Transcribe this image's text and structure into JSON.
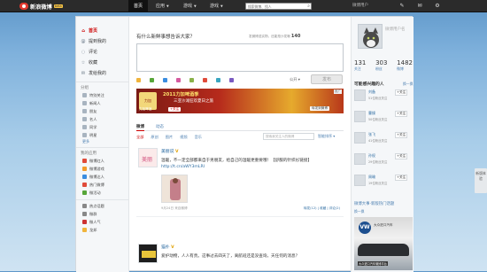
{
  "topbar": {
    "brand": "新浪微博",
    "beta": "beta",
    "nav": {
      "home": "首页",
      "apps": "应用",
      "games": "游戏",
      "games2": "游戏"
    },
    "search_placeholder": "搜索微博、找人",
    "username": "微博用户"
  },
  "left_nav": {
    "items": [
      {
        "label": "首页",
        "icon": "home-icon"
      },
      {
        "label": "提到我的",
        "icon": "at-icon"
      },
      {
        "label": "评论",
        "icon": "comment-icon"
      },
      {
        "label": "收藏",
        "icon": "star-icon"
      },
      {
        "label": "发给我的",
        "icon": "mail-icon"
      }
    ],
    "group_title": "分组",
    "groups": [
      "特别关注",
      "新闻人",
      "朋友",
      "名人",
      "同学",
      "明星"
    ],
    "group_more": "更多",
    "apps_title": "我的应用",
    "apps": [
      {
        "label": "微博红人",
        "color": "#e04b3a"
      },
      {
        "label": "微博游戏",
        "color": "#f39c2b"
      },
      {
        "label": "微博达人",
        "color": "#3a8de0"
      },
      {
        "label": "热门微博",
        "color": "#e04b3a"
      },
      {
        "label": "微活动",
        "color": "#57a639"
      }
    ],
    "bottom": [
      {
        "label": "热点话题",
        "color": "#888888"
      },
      {
        "label": "微群",
        "color": "#888888"
      },
      {
        "label": "微人气",
        "color": "#888888"
      },
      {
        "label": "龙邦",
        "color": "#888888"
      }
    ]
  },
  "publisher": {
    "title": "有什么新鲜事想告诉大家？",
    "hint": "发微博送实物，还能抢沙发哦",
    "count": "140",
    "tools": [
      {
        "label": "表情",
        "color": "#f0b43c"
      },
      {
        "label": "图片",
        "color": "#57a639"
      },
      {
        "label": "视频",
        "color": "#3a8de0"
      },
      {
        "label": "音乐",
        "color": "#d55a9f"
      },
      {
        "label": "话题",
        "color": "#8ab24a"
      },
      {
        "label": "活动",
        "color": "#e04b3a"
      },
      {
        "label": "投票",
        "color": "#3aa6c1"
      },
      {
        "label": "长微博",
        "color": "#7a5ac1"
      }
    ],
    "setting": "公开 ▾",
    "submit": "发布"
  },
  "ad": {
    "logo": "力加",
    "headline": "2011力加啤酒季",
    "subline": "三亚沙滩狂欢夏日之旅",
    "follow_name": "力加啤酒",
    "follow_btn": "+关注",
    "share_btn": "转发到微博",
    "tag": "推广"
  },
  "feed_tabs": {
    "weibo": "微博",
    "dynamic": "动态"
  },
  "filters": [
    "全部",
    "原创",
    "图片",
    "视频",
    "音乐"
  ],
  "feed_search_placeholder": "搜索我关注人的微博",
  "sort": "智能排序 ▾",
  "feed": [
    {
      "name": "美丽说",
      "text": "温暖，不一定全部都来自于男朋友，给自己的温暖更重要哦！【舒服的针织衫链接】",
      "link": "http://t.cn/aWY3mLRI",
      "meta": "9月24日  来自微博",
      "actions": "转发(12) | 收藏 | 评论(2)"
    },
    {
      "name": "猫扑",
      "text": "爱护动物，人人有责。这事过去四天了，离航班还是没查询，天任何的消息？"
    }
  ],
  "profile": {
    "name": "微博用户名",
    "stats": [
      {
        "num": "131",
        "label": "关注"
      },
      {
        "num": "303",
        "label": "粉丝"
      },
      {
        "num": "1482",
        "label": "微博"
      }
    ]
  },
  "recommend": {
    "title": "可能感兴趣的人",
    "more": "换一换",
    "people": [
      {
        "name": "刘备",
        "sub": "51位粉丝关注",
        "btn": "+关注"
      },
      {
        "name": "曹操",
        "sub": "50位粉丝关注",
        "btn": "+关注"
      },
      {
        "name": "张飞",
        "sub": "41位粉丝关注",
        "btn": "+关注"
      },
      {
        "name": "孙权",
        "sub": "29位粉丝关注",
        "btn": "+关注"
      },
      {
        "name": "周瑜",
        "sub": "19位粉丝关注",
        "btn": "+关注"
      }
    ]
  },
  "hot": {
    "title": "微博大事·新版热门话题",
    "more": "换一换"
  },
  "right_ad": {
    "brand": "VW",
    "caption": "大众进口汽车",
    "caption2": "大众进口汽车微博平台"
  },
  "version_btn": "新版体验"
}
